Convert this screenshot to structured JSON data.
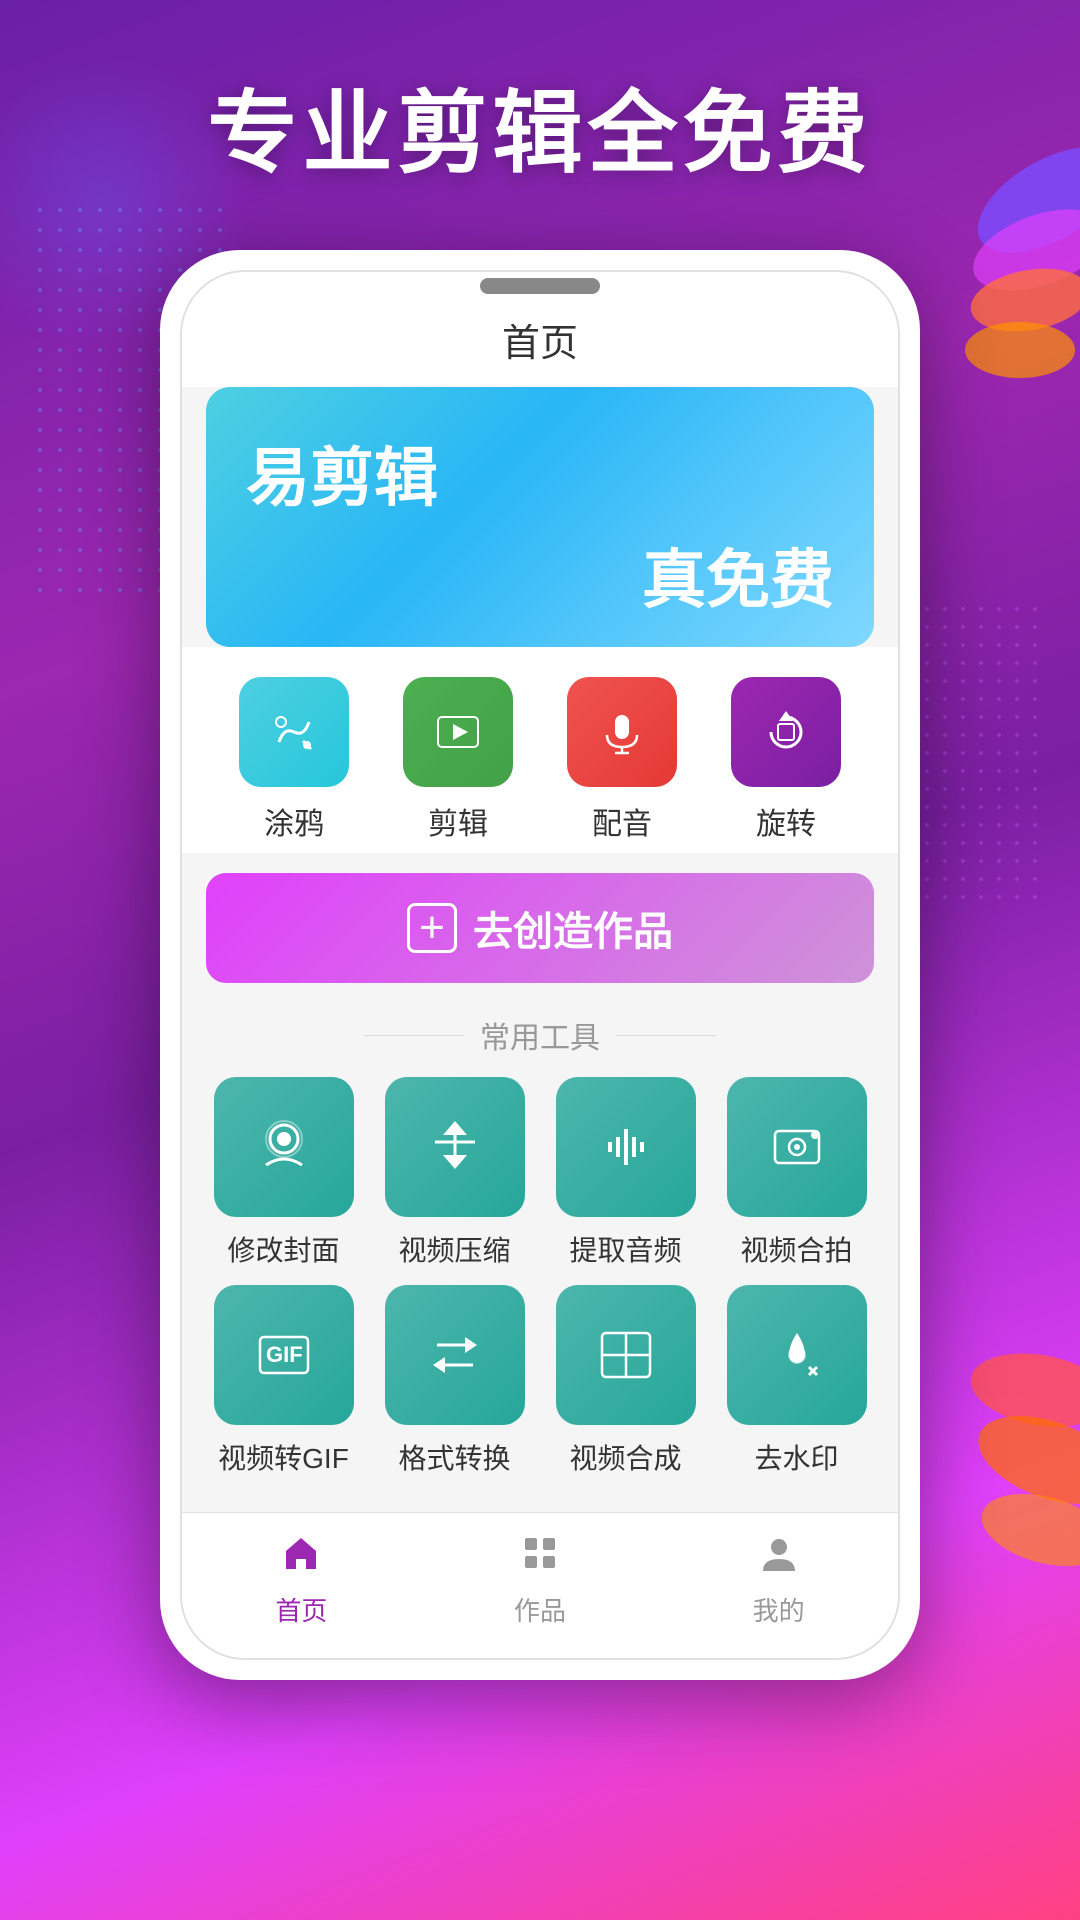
{
  "hero": {
    "title": "专业剪辑全免费"
  },
  "phone": {
    "screen_title": "首页",
    "banner": {
      "line1": "易剪辑",
      "line2": "真免费"
    },
    "quick_tools": [
      {
        "id": "doodle",
        "label": "涂鸦",
        "icon": "✏️",
        "color": "cyan"
      },
      {
        "id": "edit",
        "label": "剪辑",
        "icon": "▶",
        "color": "green"
      },
      {
        "id": "dub",
        "label": "配音",
        "icon": "🎙",
        "color": "red"
      },
      {
        "id": "rotate",
        "label": "旋转",
        "icon": "↻",
        "color": "purple"
      }
    ],
    "create_button": "去创造作品",
    "common_tools_title": "常用工具",
    "common_tools": [
      {
        "id": "cover",
        "label": "修改封面",
        "icon": "🎓"
      },
      {
        "id": "compress",
        "label": "视频压缩",
        "icon": "⬇"
      },
      {
        "id": "audio",
        "label": "提取音频",
        "icon": "🎵"
      },
      {
        "id": "collab",
        "label": "视频合拍",
        "icon": "📷"
      },
      {
        "id": "gif",
        "label": "视频转GIF",
        "icon": "GIF"
      },
      {
        "id": "convert",
        "label": "格式转换",
        "icon": "⇄"
      },
      {
        "id": "merge",
        "label": "视频合成",
        "icon": "⊟"
      },
      {
        "id": "watermark",
        "label": "去水印",
        "icon": "💧"
      }
    ],
    "nav": [
      {
        "id": "home",
        "label": "首页",
        "active": true
      },
      {
        "id": "works",
        "label": "作品",
        "active": false
      },
      {
        "id": "profile",
        "label": "我的",
        "active": false
      }
    ]
  }
}
